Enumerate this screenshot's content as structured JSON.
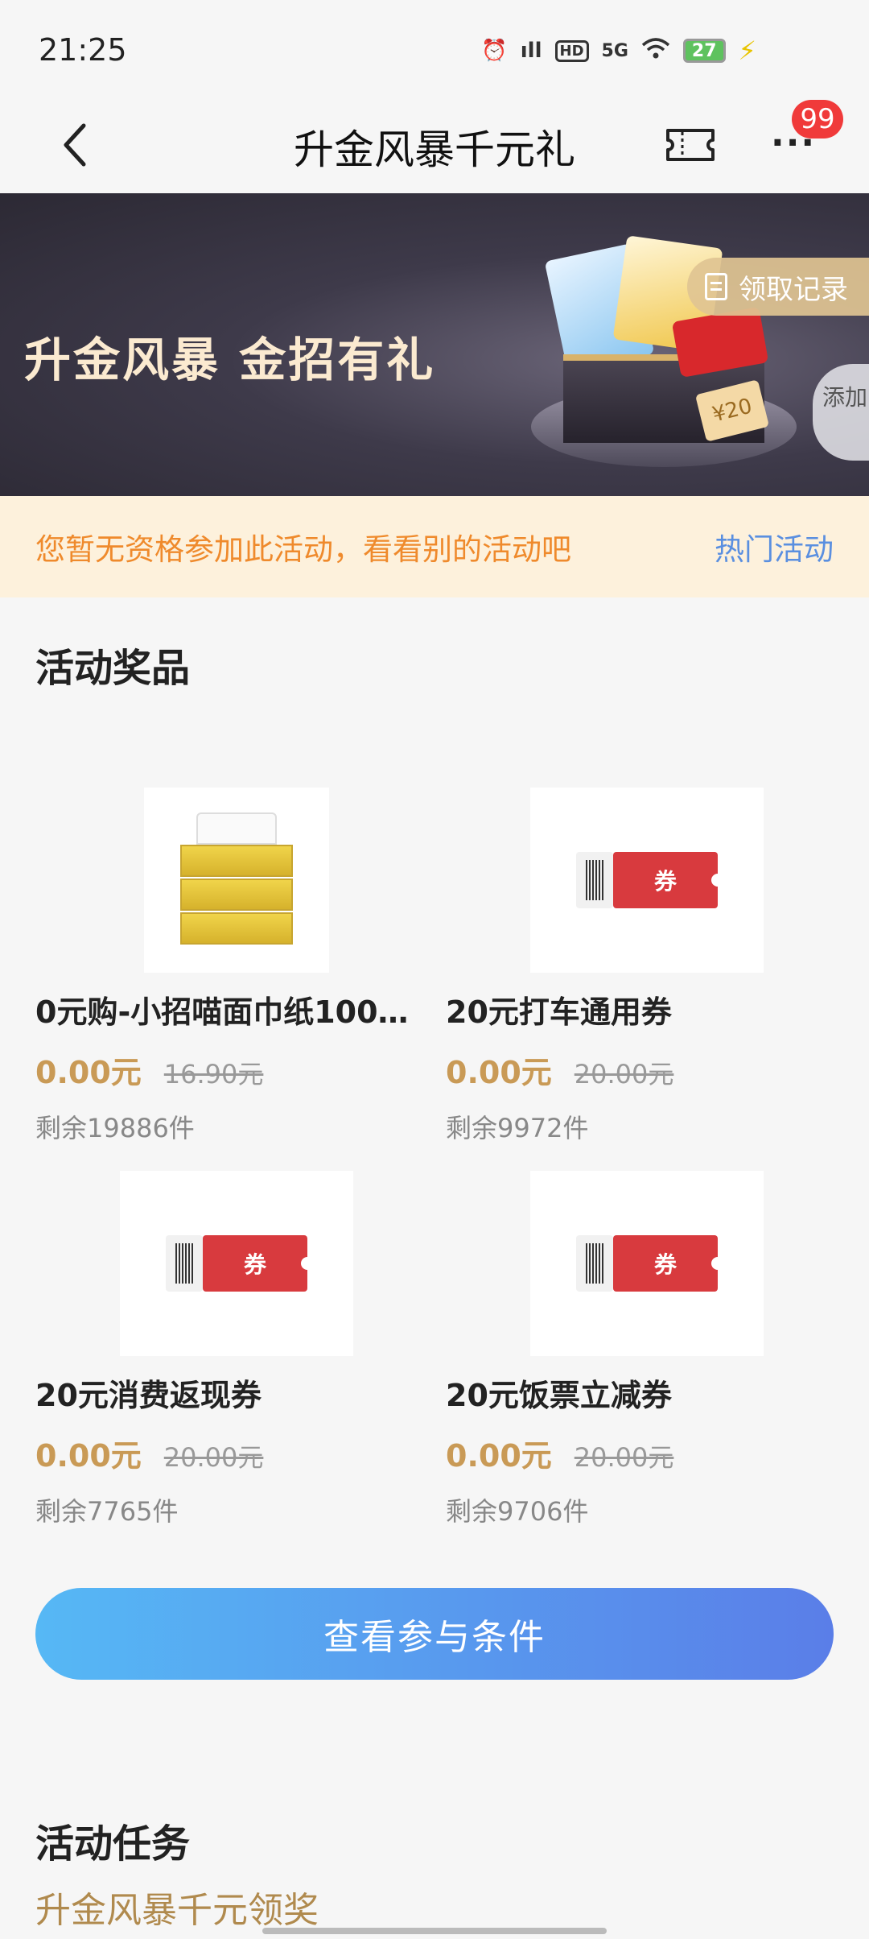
{
  "status_bar": {
    "time": "21:25",
    "network": "5G",
    "hd": "HD",
    "battery": "27",
    "icons": [
      "alarm-icon",
      "signal-icon",
      "wifi-icon",
      "battery-icon",
      "charging-icon"
    ]
  },
  "nav": {
    "title": "升金风暴千元礼",
    "badge": "99",
    "icons": [
      "back-icon",
      "ticket-icon",
      "more-icon"
    ]
  },
  "banner": {
    "title": "升金风暴 金招有礼",
    "record_label": "领取记录",
    "add_label": "添加",
    "voucher_text": "¥20"
  },
  "notice": {
    "text": "您暂无资格参加此活动，看看别的活动吧",
    "link": "热门活动"
  },
  "prizes_section": {
    "title": "活动奖品",
    "items": [
      {
        "name": "0元购-小招喵面巾纸100…",
        "price": "0.00元",
        "original_price": "16.90元",
        "stock": "剩余19886件",
        "image": "tissue"
      },
      {
        "name": "20元打车通用券",
        "price": "0.00元",
        "original_price": "20.00元",
        "stock": "剩余9972件",
        "image": "coupon",
        "coupon_label": "券"
      },
      {
        "name": "20元消费返现券",
        "price": "0.00元",
        "original_price": "20.00元",
        "stock": "剩余7765件",
        "image": "coupon",
        "coupon_label": "券"
      },
      {
        "name": "20元饭票立减券",
        "price": "0.00元",
        "original_price": "20.00元",
        "stock": "剩余9706件",
        "image": "coupon",
        "coupon_label": "券"
      }
    ]
  },
  "cta": {
    "label": "查看参与条件"
  },
  "tasks_section": {
    "title": "活动任务",
    "subtitle": "升金风暴千元领奖"
  },
  "colors": {
    "accent_gold": "#c99a56",
    "notice_orange": "#ef8a2c",
    "link_blue": "#5a8fe0",
    "badge_red": "#f03a3a",
    "cta_start": "#56b8f5",
    "cta_end": "#5a7ee8"
  }
}
